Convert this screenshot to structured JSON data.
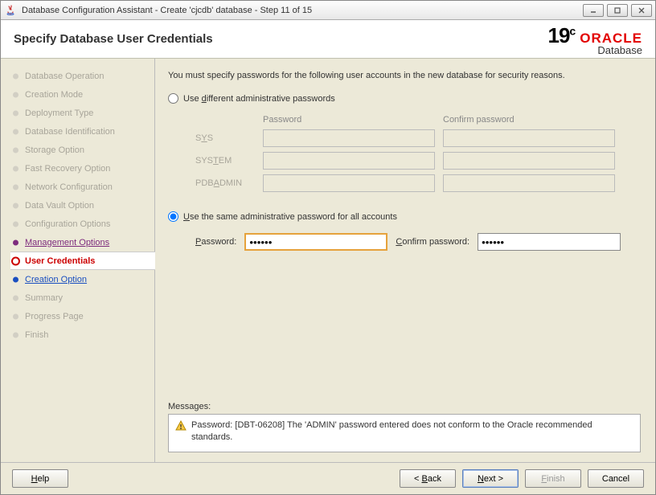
{
  "window": {
    "title": "Database Configuration Assistant - Create 'cjcdb' database - Step 11 of 15"
  },
  "header": {
    "title": "Specify Database User Credentials",
    "version": "19",
    "version_suffix": "c",
    "brand": "ORACLE",
    "product": "Database"
  },
  "sidebar": {
    "items": [
      {
        "label": "Database Operation"
      },
      {
        "label": "Creation Mode"
      },
      {
        "label": "Deployment Type"
      },
      {
        "label": "Database Identification"
      },
      {
        "label": "Storage Option"
      },
      {
        "label": "Fast Recovery Option"
      },
      {
        "label": "Network Configuration"
      },
      {
        "label": "Data Vault Option"
      },
      {
        "label": "Configuration Options"
      },
      {
        "label": "Management Options"
      },
      {
        "label": "User Credentials"
      },
      {
        "label": "Creation Option"
      },
      {
        "label": "Summary"
      },
      {
        "label": "Progress Page"
      },
      {
        "label": "Finish"
      }
    ]
  },
  "main": {
    "intro": "You must specify passwords for the following user accounts in the new database for security reasons.",
    "option_diff": "Use different administrative passwords",
    "col_password": "Password",
    "col_confirm": "Confirm password",
    "rows": {
      "sys": "SYS",
      "system": "SYSTEM",
      "pdbadmin": "PDBADMIN"
    },
    "option_same": "Use the same administrative password for all accounts",
    "label_password": "Password:",
    "label_confirm": "Confirm password:",
    "value_password": "••••••",
    "value_confirm": "••••••",
    "messages_label": "Messages:",
    "message_text": "Password: [DBT-06208] The 'ADMIN' password entered does not conform to the Oracle recommended standards."
  },
  "footer": {
    "help": "Help",
    "back": "< Back",
    "next": "Next >",
    "finish": "Finish",
    "cancel": "Cancel"
  }
}
